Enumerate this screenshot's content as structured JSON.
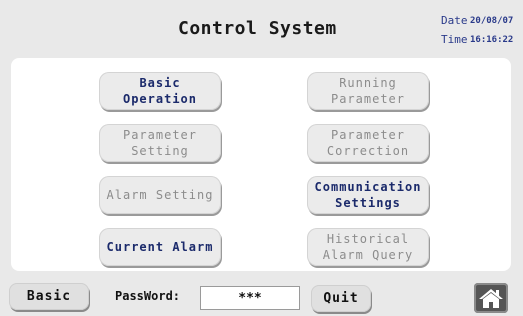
{
  "header": {
    "title": "Control System",
    "date_label": "Date",
    "date_value": "20/08/07",
    "time_label": "Time",
    "time_value": "16:16:22"
  },
  "menu": {
    "basic_operation": "Basic\nOperation",
    "running_parameter": "Running\nParameter",
    "parameter_setting": "Parameter\nSetting",
    "parameter_correction": "Parameter\nCorrection",
    "alarm_setting": "Alarm Setting",
    "communication_settings": "Communication\nSettings",
    "current_alarm": "Current Alarm",
    "historical_alarm_query": "Historical\nAlarm Query"
  },
  "footer": {
    "basic_label": "Basic",
    "password_label": "PassWord:",
    "password_value": "***",
    "quit_label": "Quit",
    "home_icon": "home-icon"
  },
  "colors": {
    "active_text": "#1b2a6b",
    "disabled_text": "#8c8c8c",
    "background": "#e9e9e9"
  }
}
